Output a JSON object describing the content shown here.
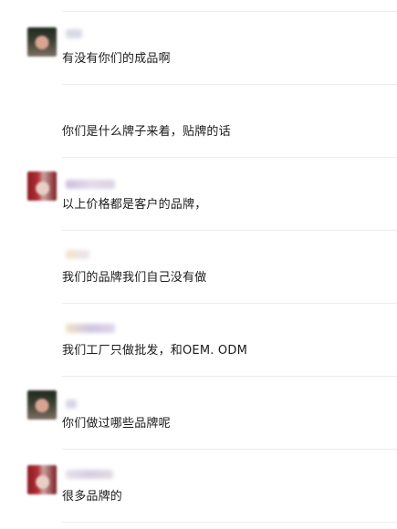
{
  "messages": [
    {
      "text": "有没有你们的成品啊"
    },
    {
      "text": "你们是什么牌子来着，贴牌的话"
    },
    {
      "text": "以上价格都是客户的品牌，"
    },
    {
      "text": "我们的品牌我们自己没有做"
    },
    {
      "text": "我们工厂只做批发，和OEM. ODM"
    },
    {
      "text": "你们做过哪些品牌呢"
    },
    {
      "text": "很多品牌的"
    }
  ],
  "colors": {
    "text": "#1a1a1a",
    "divider": "#ececec",
    "background": "#ffffff"
  }
}
